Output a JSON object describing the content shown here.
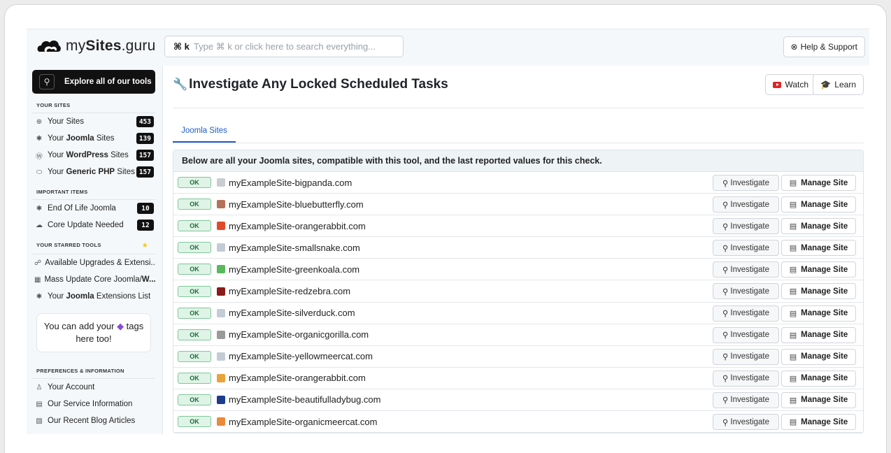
{
  "header": {
    "logo_text_plain": "my",
    "logo_text_bold": "Sites",
    "logo_text_tail": ".guru",
    "search_kbd": "⌘ k",
    "search_placeholder": "Type ⌘ k or click here to search everything...",
    "help_label": "Help & Support"
  },
  "sidebar": {
    "explore_label": "Explore all of our tools",
    "your_sites_title": "YOUR SITES",
    "your_sites": [
      {
        "pre": "Your ",
        "bold": "",
        "post": "Sites",
        "count": "453",
        "icon": "globe-icon",
        "glyph": "⊕"
      },
      {
        "pre": "Your ",
        "bold": "Joomla",
        "post": " Sites",
        "count": "139",
        "icon": "joomla-icon",
        "glyph": "✱"
      },
      {
        "pre": "Your ",
        "bold": "WordPress",
        "post": " Sites",
        "count": "157",
        "icon": "wordpress-icon",
        "glyph": "Ⓦ"
      },
      {
        "pre": "Your ",
        "bold": "Generic PHP",
        "post": " Sites",
        "count": "157",
        "icon": "php-icon",
        "glyph": "⬭"
      }
    ],
    "important_title": "IMPORTANT ITEMS",
    "important": [
      {
        "label": "End Of Life Joomla",
        "count": "10",
        "icon": "joomla-icon",
        "glyph": "✱"
      },
      {
        "label": "Core Update Needed",
        "count": "12",
        "icon": "cloud-upload-icon",
        "glyph": "☁"
      }
    ],
    "starred_title": "YOUR STARRED TOOLS",
    "starred": [
      {
        "pre": "Available Upgrades & Extensi...",
        "bold": "",
        "icon": "sitemap-icon",
        "glyph": "☍"
      },
      {
        "pre": "Mass Update Core Joomla/",
        "bold": "W...",
        "icon": "calendar-icon",
        "glyph": "▦"
      },
      {
        "pre": "Your ",
        "bold": "Joomla",
        "post": " Extensions List",
        "icon": "joomla-icon",
        "glyph": "✱"
      }
    ],
    "tags_pre": "You can add your ",
    "tags_post": " tags here too!",
    "prefs_title": "PREFERENCES & INFORMATION",
    "prefs": [
      {
        "label": "Your Account",
        "icon": "user-icon",
        "glyph": "♙"
      },
      {
        "label": "Our Service Information",
        "icon": "clipboard-icon",
        "glyph": "▤"
      },
      {
        "label": "Our Recent Blog Articles",
        "icon": "newspaper-icon",
        "glyph": "▧"
      }
    ]
  },
  "main": {
    "title": "Investigate Any Locked Scheduled Tasks",
    "watch_label": "Watch",
    "learn_label": "Learn",
    "tab_label": "Joomla Sites",
    "table_header": "Below are all your Joomla sites, compatible with this tool, and the last reported values for this check.",
    "status_label": "OK",
    "investigate_label": "Investigate",
    "manage_label": "Manage Site",
    "rows": [
      {
        "site": "myExampleSite-bigpanda.com",
        "fav_color": "#c9cdd2"
      },
      {
        "site": "myExampleSite-bluebutterfly.com",
        "fav_color": "#b5725a"
      },
      {
        "site": "myExampleSite-orangerabbit.com",
        "fav_color": "#e04a2a"
      },
      {
        "site": "myExampleSite-smallsnake.com",
        "fav_color": "#c3ccd6"
      },
      {
        "site": "myExampleSite-greenkoala.com",
        "fav_color": "#5cb85c"
      },
      {
        "site": "myExampleSite-redzebra.com",
        "fav_color": "#8b1a1a"
      },
      {
        "site": "myExampleSite-silverduck.com",
        "fav_color": "#c3ccd6"
      },
      {
        "site": "myExampleSite-organicgorilla.com",
        "fav_color": "#9a9a9a"
      },
      {
        "site": "myExampleSite-yellowmeercat.com",
        "fav_color": "#c3ccd6"
      },
      {
        "site": "myExampleSite-orangerabbit.com",
        "fav_color": "#e8a33a"
      },
      {
        "site": "myExampleSite-beautifulladybug.com",
        "fav_color": "#1c3c8c"
      },
      {
        "site": "myExampleSite-organicmeercat.com",
        "fav_color": "#e88a3a"
      }
    ]
  }
}
